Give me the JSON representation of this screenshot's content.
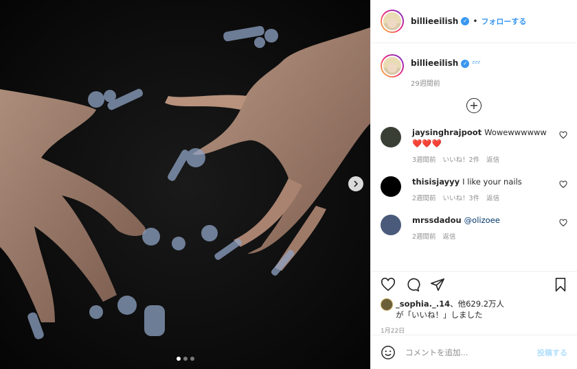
{
  "post": {
    "carousel": {
      "total": 3,
      "active": 0
    }
  },
  "header": {
    "username": "billieeilish",
    "separator": "•",
    "follow_label": "フォローする"
  },
  "caption": {
    "username": "billieeilish",
    "text": "ᶻᶻᶻ",
    "time": "29週間前"
  },
  "comments": [
    {
      "username": "jaysinghrajpoot",
      "text": "Wowewwwwww",
      "emoji": "❤️❤️❤️",
      "time": "3週間前",
      "likes": "いいね！2件",
      "reply": "返信",
      "avatar_color": "#3a3f36"
    },
    {
      "username": "thisisjayyy",
      "text": "I like your nails",
      "time": "2週間前",
      "likes": "いいね！3件",
      "reply": "返信",
      "avatar_color": "#000000"
    },
    {
      "username": "mrssdadou",
      "text": "@olizoee",
      "time": "2週間前",
      "reply": "返信",
      "avatar_color": "#4a5a7a"
    }
  ],
  "likes": {
    "user": "_sophia._.14",
    "others": "、他629.2万人",
    "suffix": "が「いいね！」しました"
  },
  "date": "1月22日",
  "composer": {
    "placeholder": "コメントを追加...",
    "post_label": "投稿する"
  },
  "icons": [
    "next-arrow-icon",
    "add-icon",
    "heart-icon",
    "comment-icon",
    "share-icon",
    "bookmark-icon",
    "emoji-icon",
    "verified-icon"
  ],
  "colors": {
    "accent": "#3897f0",
    "muted": "#8e8e8e",
    "heart_red": "#ed4956"
  }
}
